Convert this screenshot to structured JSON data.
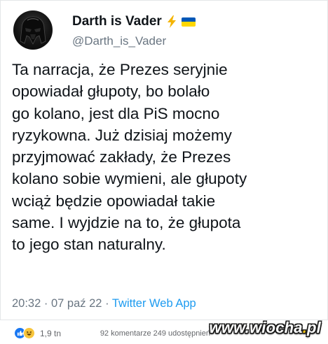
{
  "tweet": {
    "author": {
      "display_name": "Darth is Vader",
      "verified_icon": "lightning-bolt-emoji",
      "flag_icon": "ukraine-flag-emoji",
      "handle": "@Darth_is_Vader"
    },
    "text_lines": [
      "Ta narracja, że Prezes seryjnie",
      "opowiadał głupoty, bo bolało",
      "go kolano, jest dla PiS mocno",
      "ryzykowna. Już dzisiaj możemy",
      "przyjmować zakłady, że Prezes",
      "kolano sobie wymieni, ale głupoty",
      "wciąż będzie opowiadał takie",
      "same. I wyjdzie na to, że głupota",
      "to jego stan naturalny."
    ],
    "time": "20:32",
    "date": "07 paź 22",
    "separator": "·",
    "source": "Twitter Web App"
  },
  "footer": {
    "reaction_icons": [
      "like-icon",
      "haha-icon"
    ],
    "reaction_count": "1,9 tn",
    "comments": "92 komentarze",
    "shares": "249 udostępnień"
  },
  "watermark": {
    "main": "www.wiocha",
    "dot": ".",
    "tld": "pl"
  },
  "colors": {
    "text": "#0f1419",
    "secondary": "#6a7682",
    "link": "#1d9bf0",
    "like_blue": "#1877f2",
    "haha_yellow": "#f7c53c",
    "flag_blue": "#0057b7",
    "flag_yellow": "#ffd700",
    "lightning": "#f4b400"
  }
}
